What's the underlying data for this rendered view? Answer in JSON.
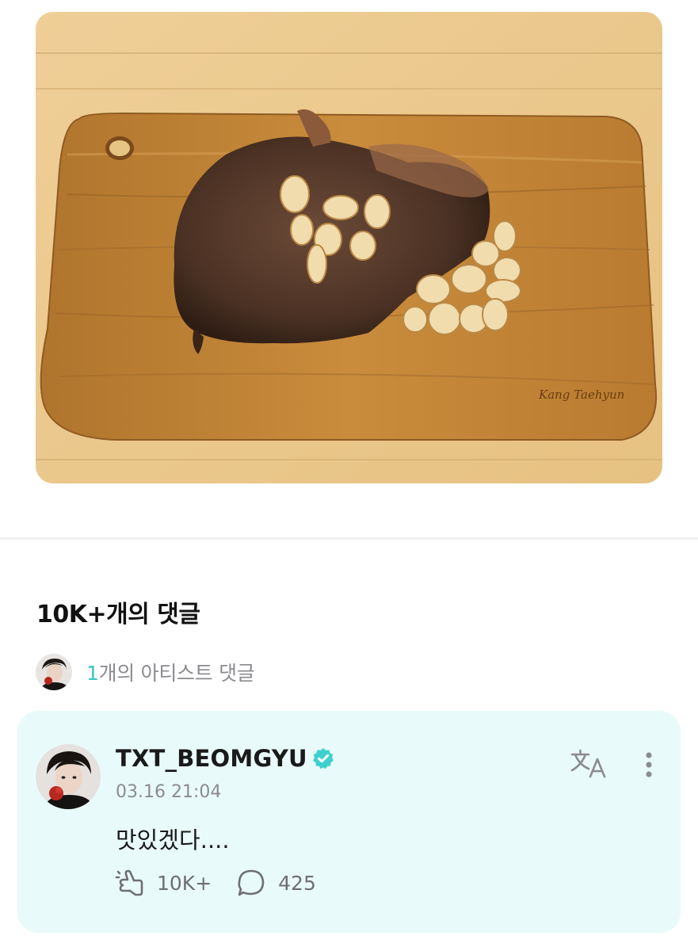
{
  "post_image": {
    "alt": "steak with garlic on wooden cutting board",
    "signature": "Kang Taehyun"
  },
  "comments": {
    "heading": "10K+개의 댓글",
    "artist_summary": {
      "count": "1",
      "label": "개의 아티스트 댓글"
    }
  },
  "comment": {
    "username": "TXT_BEOMGYU",
    "verified": true,
    "timestamp": "03.16 21:04",
    "text": "맛있겠다....",
    "likes": "10K+",
    "replies": "425"
  },
  "icons": {
    "verified": "verified-badge-icon",
    "translate": "translate-icon",
    "more": "more-vertical-icon",
    "like": "like-icon",
    "reply": "reply-bubble-icon"
  },
  "colors": {
    "accent": "#36c7c5",
    "card_background": "#e9fafa",
    "muted_text": "#8b8b90"
  }
}
